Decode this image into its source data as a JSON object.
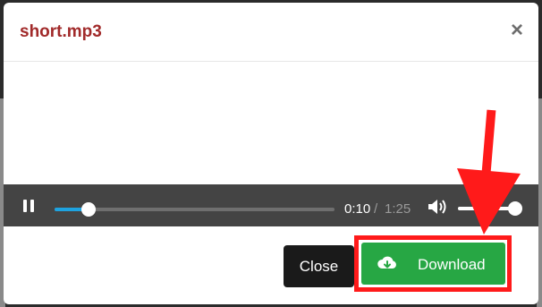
{
  "modal": {
    "title": "short.mp3",
    "close_glyph": "×",
    "close_icon": "close-icon"
  },
  "player": {
    "state": "playing",
    "pause_icon": "pause-icon",
    "current_time": "0:10",
    "separator": "/",
    "total_time": "1:25",
    "progress_fraction": 0.12,
    "volume_icon": "volume-icon",
    "volume_fraction": 1.0
  },
  "footer": {
    "close_label": "Close",
    "download_label": "Download",
    "download_icon": "cloud-download-icon"
  },
  "annotation": {
    "color": "#ff1a1a",
    "arrow": "arrow-down-icon"
  },
  "colors": {
    "title": "#a12a2a",
    "download": "#27a744",
    "seek": "#1ea3e0"
  }
}
